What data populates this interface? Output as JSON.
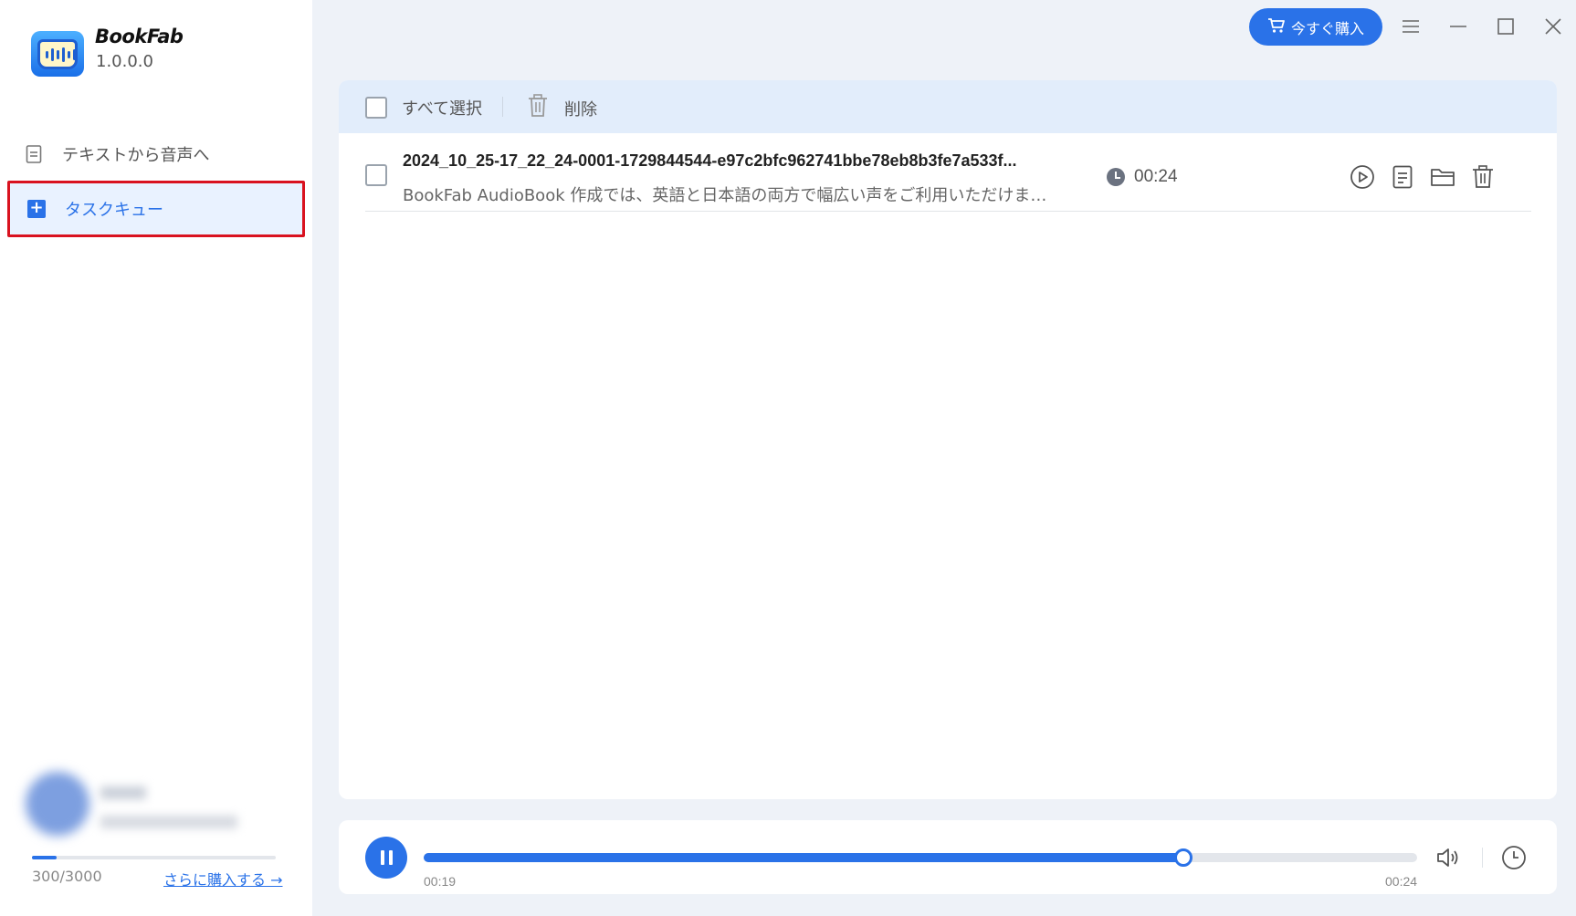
{
  "app": {
    "name": "BookFab",
    "version": "1.0.0.0"
  },
  "sidebar": {
    "items": [
      {
        "label": "テキストから音声へ",
        "icon": "document-icon",
        "active": false
      },
      {
        "label": "タスクキュー",
        "icon": "queue-icon",
        "active": true
      }
    ],
    "quota": {
      "text": "300/3000",
      "used": 300,
      "total": 3000
    },
    "buy_more_label": "さらに購入する →"
  },
  "titlebar": {
    "buy_label": "今すぐ購入",
    "buy_icon": "cart-icon",
    "controls": [
      "menu-icon",
      "minimize-icon",
      "maximize-icon",
      "close-icon"
    ]
  },
  "toolbar": {
    "select_all_label": "すべて選択",
    "delete_label": "削除"
  },
  "tasks": [
    {
      "title": "2024_10_25-17_22_24-0001-1729844544-e97c2bfc962741bbe78eb8b3fe7a533f...",
      "description": "BookFab AudioBook 作成では、英語と日本語の両方で幅広い声をご利用いただけます....",
      "duration": "00:24",
      "actions": [
        "play-icon",
        "text-file-icon",
        "folder-icon",
        "delete-icon"
      ]
    }
  ],
  "player": {
    "state": "playing",
    "current_time": "00:19",
    "total_time": "00:24",
    "progress_fraction": 0.765
  },
  "colors": {
    "accent": "#2a72e8",
    "highlight_border": "#d9121f",
    "background": "#eef2f8"
  }
}
